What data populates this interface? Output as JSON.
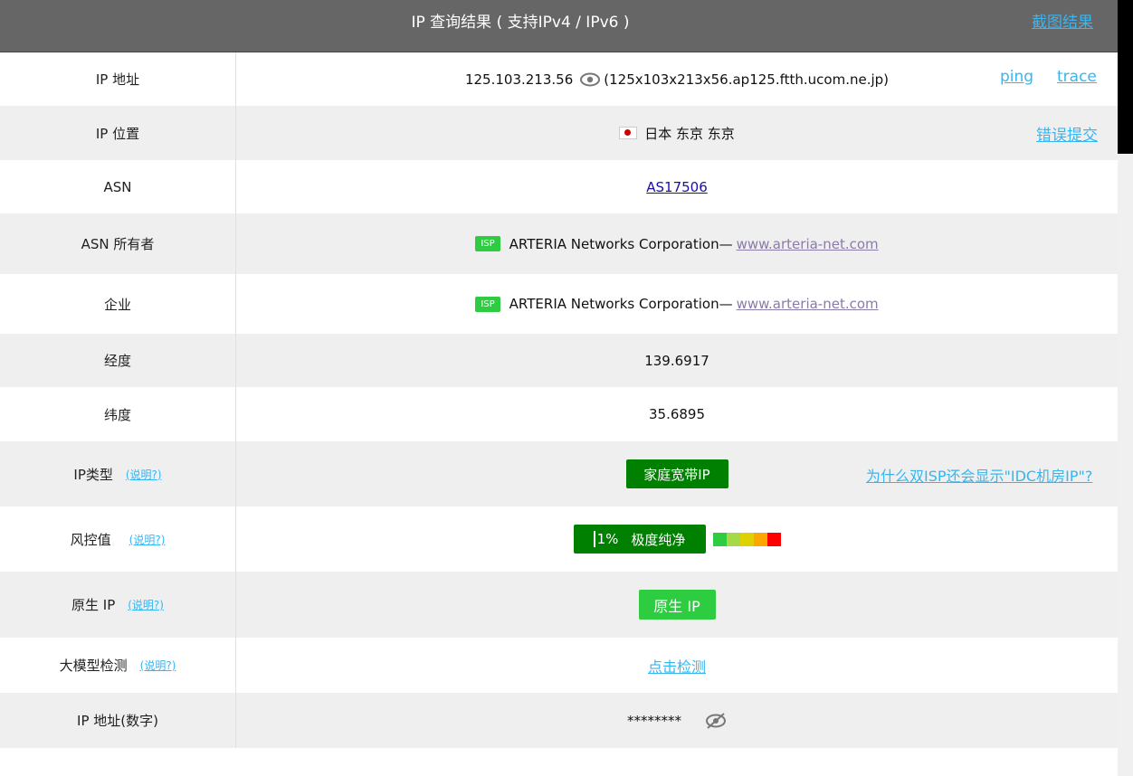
{
  "header": {
    "title": "IP 查询结果 ( 支持IPv4 / IPv6 )",
    "screenshot_link": "截图结果"
  },
  "rows": {
    "ip": {
      "label": "IP 地址",
      "value": "125.103.213.56",
      "host": "(125x103x213x56.ap125.ftth.ucom.ne.jp)",
      "ping": "ping",
      "trace": "trace"
    },
    "location": {
      "label": "IP 位置",
      "value": "日本 东京 东京",
      "report": "错误提交"
    },
    "asn": {
      "label": "ASN",
      "value": "AS17506"
    },
    "asn_owner": {
      "label": "ASN 所有者",
      "badge": "ISP",
      "name": "ARTERIA Networks Corporation—",
      "site": "www.arteria-net.com"
    },
    "company": {
      "label": "企业",
      "badge": "ISP",
      "name": "ARTERIA Networks Corporation—",
      "site": "www.arteria-net.com"
    },
    "longitude": {
      "label": "经度",
      "value": "139.6917"
    },
    "latitude": {
      "label": "纬度",
      "value": "35.6895"
    },
    "ip_type": {
      "label": "IP类型",
      "hint": "(说明?)",
      "value": "家庭宽带IP",
      "why": "为什么双ISP还会显示\"IDC机房IP\"?"
    },
    "risk": {
      "label": "风控值",
      "hint": "(说明?)",
      "percent": "1%",
      "value": "极度纯净",
      "colors": [
        "#2ecc40",
        "#a6d94a",
        "#e0d000",
        "#ffa500",
        "#ff0000"
      ]
    },
    "native": {
      "label": "原生 IP",
      "hint": "(说明?)",
      "value": "原生 IP"
    },
    "llm": {
      "label": "大模型检测",
      "hint": "(说明?)",
      "value": "点击检测"
    },
    "ip_numeric": {
      "label": "IP 地址(数字)",
      "value": "********"
    }
  },
  "colors": {
    "header_bg": "#666666",
    "link": "#35b6f2",
    "dark_green": "#008000",
    "light_green": "#2ecc40"
  }
}
